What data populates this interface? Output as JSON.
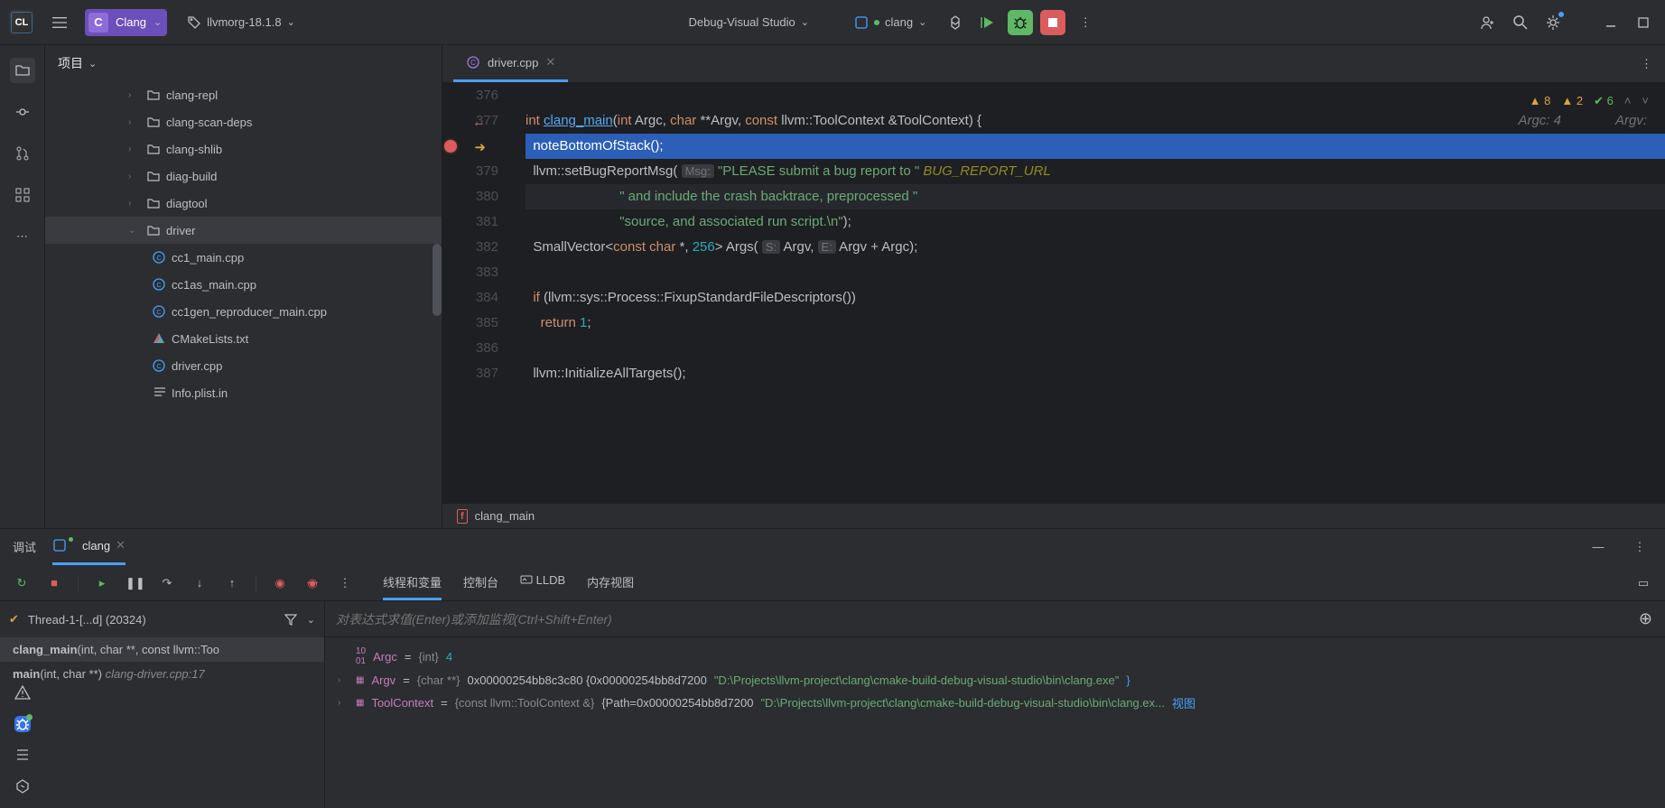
{
  "titlebar": {
    "project_name": "Clang",
    "project_initial": "C",
    "tag_label": "llvmorg-18.1.8",
    "build_config": "Debug-Visual Studio",
    "run_target": "clang"
  },
  "project_pane": {
    "title": "项目",
    "tree": [
      {
        "type": "folder",
        "name": "clang-repl",
        "depth": 2,
        "expanded": false
      },
      {
        "type": "folder",
        "name": "clang-scan-deps",
        "depth": 2,
        "expanded": false
      },
      {
        "type": "folder",
        "name": "clang-shlib",
        "depth": 2,
        "expanded": false
      },
      {
        "type": "folder",
        "name": "diag-build",
        "depth": 2,
        "expanded": false
      },
      {
        "type": "folder",
        "name": "diagtool",
        "depth": 2,
        "expanded": false
      },
      {
        "type": "folder",
        "name": "driver",
        "depth": 2,
        "expanded": true,
        "selected": true
      },
      {
        "type": "file",
        "name": "cc1_main.cpp",
        "depth": 3,
        "icon": "cpp"
      },
      {
        "type": "file",
        "name": "cc1as_main.cpp",
        "depth": 3,
        "icon": "cpp"
      },
      {
        "type": "file",
        "name": "cc1gen_reproducer_main.cpp",
        "depth": 3,
        "icon": "cpp"
      },
      {
        "type": "file",
        "name": "CMakeLists.txt",
        "depth": 3,
        "icon": "cmake"
      },
      {
        "type": "file",
        "name": "driver.cpp",
        "depth": 3,
        "icon": "cpp"
      },
      {
        "type": "file",
        "name": "Info.plist.in",
        "depth": 3,
        "icon": "txt"
      }
    ]
  },
  "editor": {
    "tab_name": "driver.cpp",
    "inspections": {
      "warn1": 8,
      "warn2": 2,
      "ok": 6
    },
    "inlay_right": {
      "argc": "Argc: 4",
      "argv": "Argv:"
    },
    "breadcrumb": "clang_main",
    "lines": [
      {
        "n": 376,
        "html": ""
      },
      {
        "n": 377,
        "html": "<span class='kw'>int</span> <span class='fn'>clang_main</span>(<span class='kw'>int</span> Argc, <span class='kw'>char</span> **Argv, <span class='kw'>const</span> llvm::ToolContext &amp;ToolContext) {",
        "def": true
      },
      {
        "n": "",
        "html": "  noteBottomOfStack();",
        "exec": true,
        "bp": true
      },
      {
        "n": 379,
        "html": "  llvm::setBugReportMsg( <span class='param-hint'>Msg:</span> <span class='str'>\"PLEASE submit a bug report to \"</span> <span class='macro'>BUG_REPORT_URL</span>"
      },
      {
        "n": 380,
        "html": "                         <span class='str'>\" and include the crash backtrace, preprocessed \"</span>",
        "cursor": true
      },
      {
        "n": 381,
        "html": "                         <span class='str'>\"source, and associated run script.\\n\"</span>);"
      },
      {
        "n": 382,
        "html": "  SmallVector&lt;<span class='kw'>const</span> <span class='kw'>char</span> *, <span class='num'>256</span>&gt; Args( <span class='param-hint'>S:</span> Argv, <span class='param-hint'>E:</span> Argv + Argc);"
      },
      {
        "n": 383,
        "html": ""
      },
      {
        "n": 384,
        "html": "  <span class='kw'>if</span> (llvm::sys::Process::FixupStandardFileDescriptors())"
      },
      {
        "n": 385,
        "html": "    <span class='kw'>return</span> <span class='num'>1</span>;"
      },
      {
        "n": 386,
        "html": ""
      },
      {
        "n": 387,
        "html": "  llvm::InitializeAllTargets();"
      }
    ]
  },
  "debug": {
    "panel_label": "调试",
    "session_name": "clang",
    "sub_tabs": [
      "线程和变量",
      "控制台",
      "LLDB",
      "内存视图"
    ],
    "thread": "Thread-1-[...d] (20324)",
    "frames": [
      {
        "fn": "clang_main",
        "sig": "(int, char **, const llvm::Too",
        "sel": true
      },
      {
        "fn": "main",
        "sig": "(int, char **)",
        "loc": "clang-driver.cpp:17"
      }
    ],
    "eval_placeholder": "对表达式求值(Enter)或添加监视(Ctrl+Shift+Enter)",
    "vars": [
      {
        "exp": false,
        "name": "Argc",
        "type": "{int}",
        "val": "4",
        "val_kind": "num"
      },
      {
        "exp": true,
        "name": "Argv",
        "type": "{char **}",
        "val": "0x00000254bb8c3c80 {0x00000254bb8d7200 ",
        "str": "\"D:\\Projects\\llvm-project\\clang\\cmake-build-debug-visual-studio\\bin\\clang.exe\"",
        "suffix": "}"
      },
      {
        "exp": true,
        "name": "ToolContext",
        "type": "{const llvm::ToolContext &}",
        "val": "{Path=0x00000254bb8d7200 ",
        "str": "\"D:\\Projects\\llvm-project\\clang\\cmake-build-debug-visual-studio\\bin\\clang.ex...",
        "suffix": "视图"
      }
    ]
  }
}
